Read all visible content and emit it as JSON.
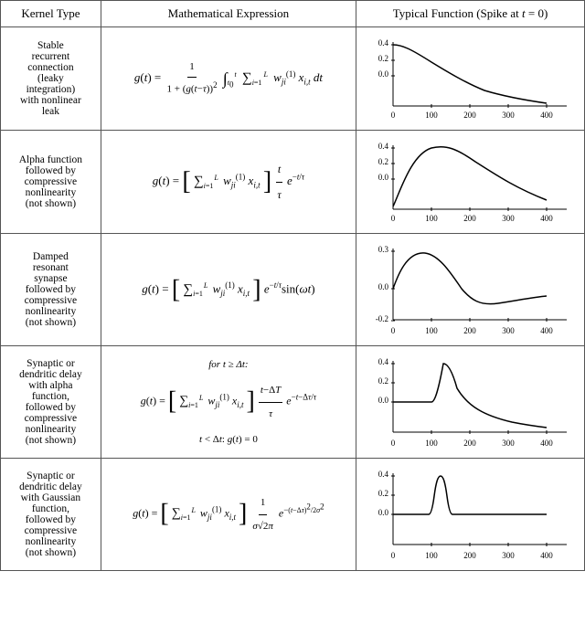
{
  "header": {
    "col1": "Kernel Type",
    "col2": "Mathematical Expression",
    "col3": "Typical Function (Spike at t = 0)"
  },
  "rows": [
    {
      "kernel": "Stable\nrecurrent\nconnection\n(leaky\nintegration)\nwith nonlinear\nleak",
      "math_label": "row1_math",
      "func_label": "row1_func"
    },
    {
      "kernel": "Alpha function\nfollowed by\ncompressive\nnonlinearity\n(not shown)",
      "math_label": "row2_math",
      "func_label": "row2_func"
    },
    {
      "kernel": "Damped\nresonant\nsynapse\nfollowed by\ncompressive\nnonlinearity\n(not shown)",
      "math_label": "row3_math",
      "func_label": "row3_func"
    },
    {
      "kernel": "Synaptic or\ndendritic delay\nwith alpha\nfunction,\nfollowed by\ncompressive\nnonlinearity\n(not shown)",
      "math_label": "row4_math",
      "func_label": "row4_func"
    },
    {
      "kernel": "Synaptic or\ndendritic delay\nwith Gaussian\nfunction,\nfollowed by\ncompressive\nnonlinearity\n(not shown)",
      "math_label": "row5_math",
      "func_label": "row5_func"
    }
  ]
}
